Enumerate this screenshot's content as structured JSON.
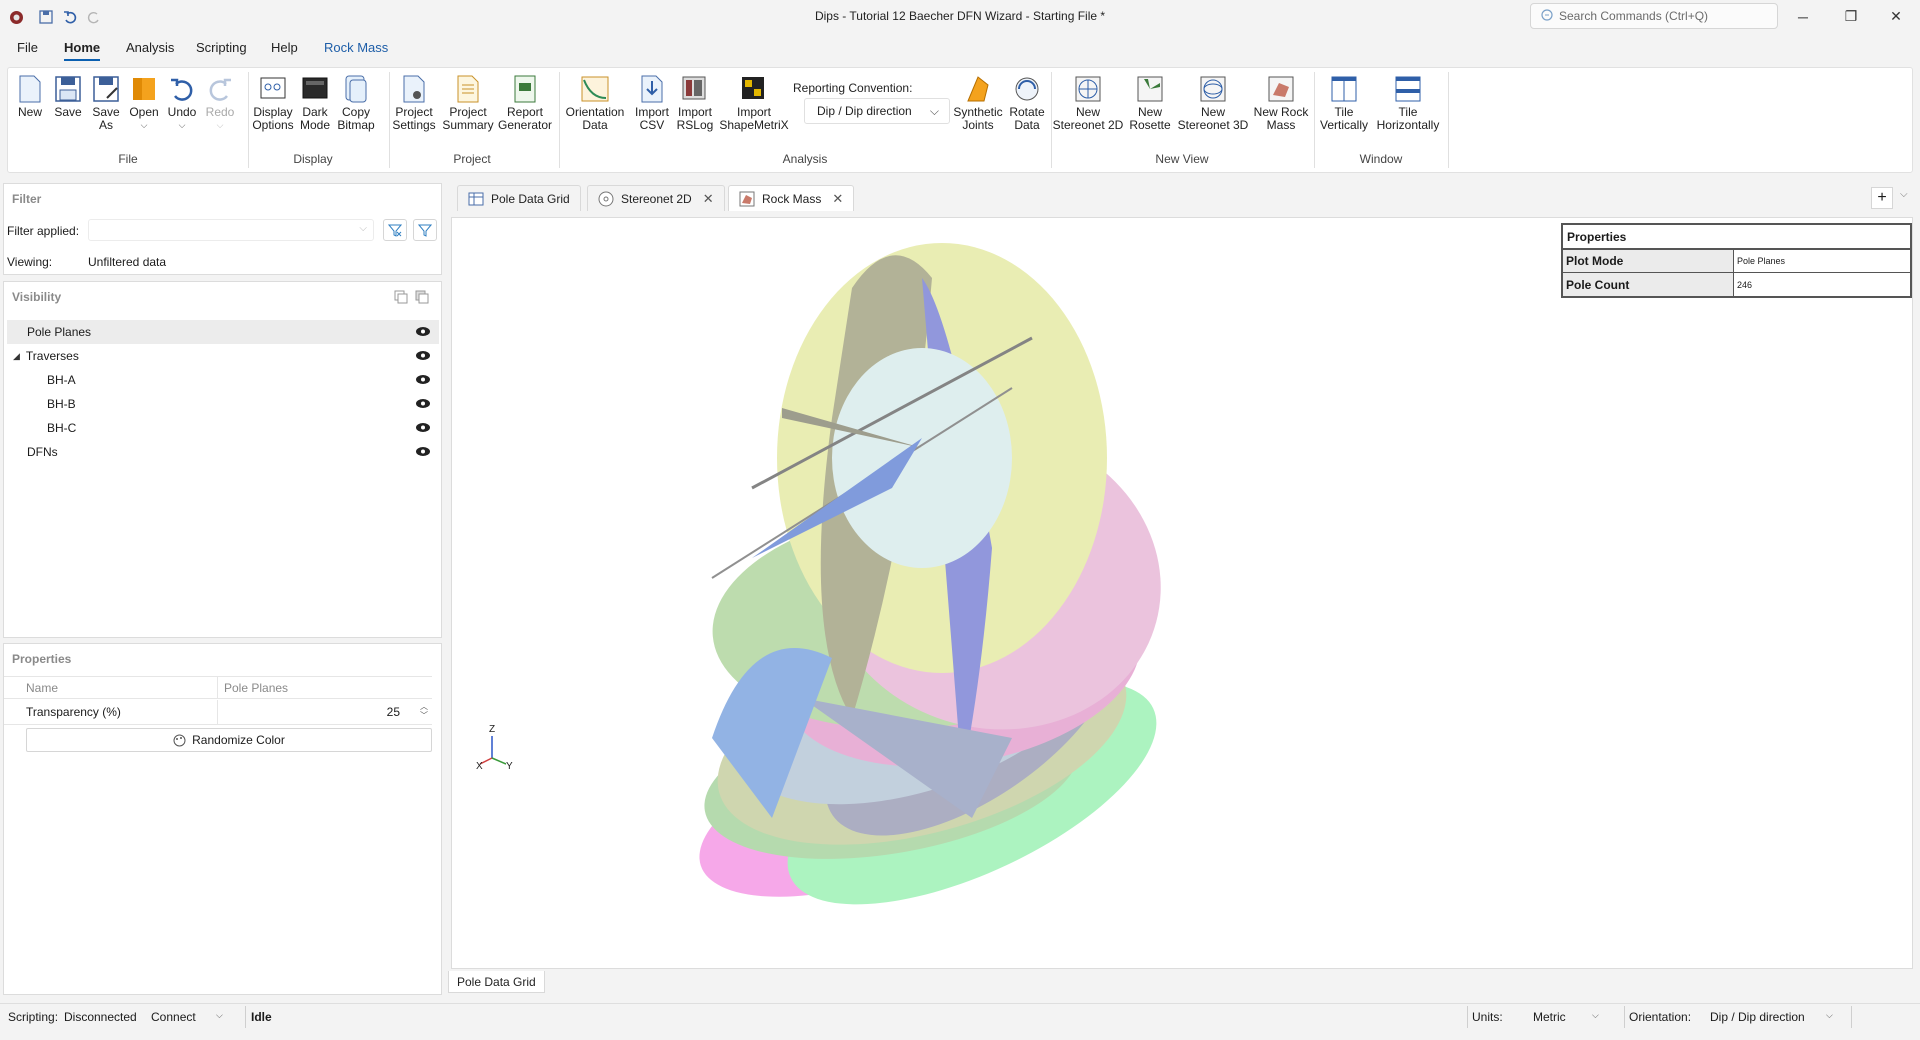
{
  "window": {
    "title": "Dips - Tutorial 12 Baecher DFN Wizard - Starting File *",
    "search_placeholder": "Search Commands (Ctrl+Q)"
  },
  "menu": [
    "File",
    "Home",
    "Analysis",
    "Scripting",
    "Help",
    "Rock Mass"
  ],
  "ribbon": {
    "file": {
      "label": "File",
      "new": "New",
      "save": "Save",
      "save_as": "Save\nAs",
      "open": "Open",
      "undo": "Undo",
      "redo": "Redo"
    },
    "display": {
      "label": "Display",
      "display_options": "Display\nOptions",
      "dark_mode": "Dark\nMode",
      "copy_bitmap": "Copy\nBitmap"
    },
    "project": {
      "label": "Project",
      "settings": "Project\nSettings",
      "summary": "Project\nSummary",
      "report": "Report\nGenerator"
    },
    "analysis": {
      "label": "Analysis",
      "orientation": "Orientation\nData",
      "import_csv": "Import\nCSV",
      "import_rslog": "Import\nRSLog",
      "import_smx": "Import\nShapeMetriX",
      "conv_label": "Reporting Convention:",
      "conv_value": "Dip / Dip direction",
      "synthetic": "Synthetic\nJoints",
      "rotate": "Rotate\nData"
    },
    "new_view": {
      "label": "New View",
      "stereonet2d": "New\nStereonet 2D",
      "rosette": "New\nRosette",
      "stereonet3d": "New\nStereonet 3D",
      "rock_mass": "New Rock\nMass"
    },
    "window": {
      "label": "Window",
      "tile_v": "Tile\nVertically",
      "tile_h": "Tile\nHorizontally"
    }
  },
  "filter": {
    "title": "Filter",
    "applied_label": "Filter applied:",
    "viewing_label": "Viewing:",
    "viewing_value": "Unfiltered data"
  },
  "visibility": {
    "title": "Visibility",
    "items": [
      "Pole Planes",
      "Traverses",
      "BH-A",
      "BH-B",
      "BH-C",
      "DFNs"
    ]
  },
  "properties": {
    "title": "Properties",
    "col_name": "Name",
    "col_value": "Pole Planes",
    "transparency_label": "Transparency (%)",
    "transparency_value": "25",
    "randomize": "Randomize Color"
  },
  "tabs": [
    "Pole Data Grid",
    "Stereonet 2D",
    "Rock Mass"
  ],
  "bottom_tab": "Pole Data Grid",
  "rock_mass_props": {
    "title": "Properties",
    "rows": [
      {
        "key": "Plot Mode",
        "value": "Pole Planes"
      },
      {
        "key": "Pole Count",
        "value": "246"
      }
    ]
  },
  "axes": {
    "z": "Z",
    "x": "X",
    "y": "Y"
  },
  "status": {
    "scripting_label": "Scripting:",
    "scripting_value": "Disconnected",
    "connect": "Connect",
    "state": "Idle",
    "units_label": "Units:",
    "units_value": "Metric",
    "orientation_label": "Orientation:",
    "orientation_value": "Dip / Dip direction"
  }
}
